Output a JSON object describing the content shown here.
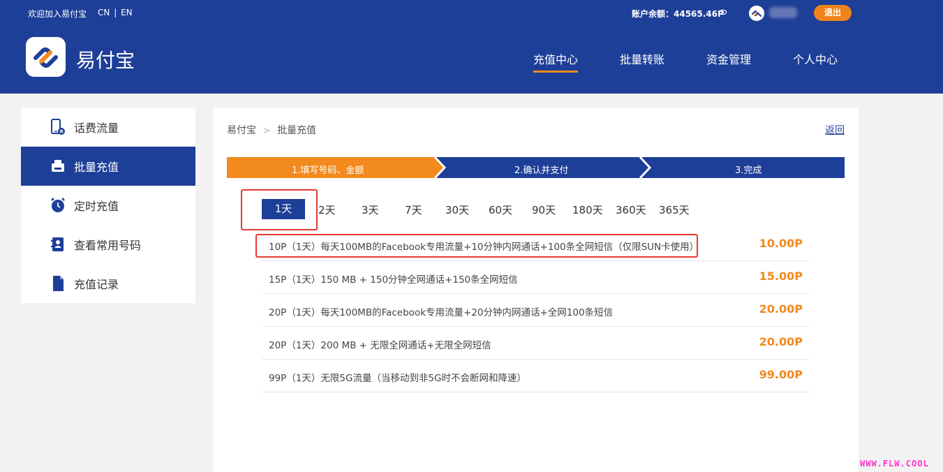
{
  "topbar": {
    "welcome": "欢迎加入易付宝",
    "lang_cn": "CN",
    "lang_sep": "|",
    "lang_en": "EN",
    "balance": "账户余额：44565.46P",
    "logout": "退出"
  },
  "header": {
    "brand": "易付宝",
    "nav": [
      {
        "label": "充值中心"
      },
      {
        "label": "批量转账"
      },
      {
        "label": "资金管理"
      },
      {
        "label": "个人中心"
      }
    ]
  },
  "sidebar": {
    "items": [
      {
        "label": "话费流量",
        "icon": "phone-icon"
      },
      {
        "label": "批量充值",
        "icon": "printer-icon"
      },
      {
        "label": "定时充值",
        "icon": "alarm-clock-icon"
      },
      {
        "label": "查看常用号码",
        "icon": "contact-book-icon"
      },
      {
        "label": "充值记录",
        "icon": "document-icon"
      }
    ]
  },
  "main": {
    "breadcrumb": [
      "易付宝",
      "批量充值"
    ],
    "breadcrumb_sep": ">",
    "back": "返回",
    "steps": [
      {
        "label": "1.填写号码、金额"
      },
      {
        "label": "2.确认并支付"
      },
      {
        "label": "3.完成"
      }
    ],
    "days": [
      "1天",
      "2天",
      "3天",
      "7天",
      "30天",
      "60天",
      "90天",
      "180天",
      "360天",
      "365天"
    ],
    "plans": [
      {
        "name": "10P（1天）每天100MB的Facebook专用流量+10分钟内网通话+100条全网短信（仅限SUN卡使用）",
        "price": "10.00P"
      },
      {
        "name": "15P（1天）150 MB + 150分钟全网通话+150条全网短信",
        "price": "15.00P"
      },
      {
        "name": "20P（1天）每天100MB的Facebook专用流量+20分钟内网通话+全网100条短信",
        "price": "20.00P"
      },
      {
        "name": "20P（1天）200 MB + 无限全网通话+无限全网短信",
        "price": "20.00P"
      },
      {
        "name": "99P（1天）无限5G流量（当移动到非5G时不会断网和降速）",
        "price": "99.00P"
      }
    ]
  },
  "colors": {
    "primary": "#1e3f98",
    "accent": "#f28a1d",
    "highlight": "#e53935"
  },
  "watermark": "WWW.FLW.COOL"
}
